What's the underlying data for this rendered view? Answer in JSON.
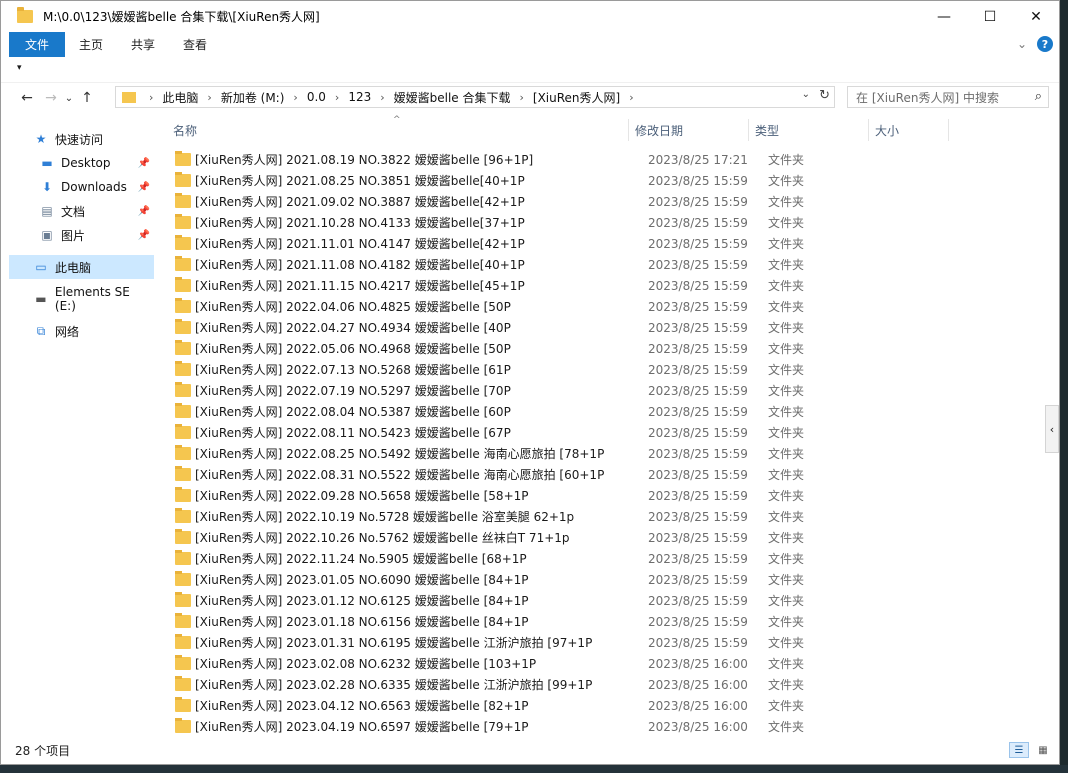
{
  "window": {
    "title": "M:\\0.0\\123\\嫒嫒酱belle 合集下载\\[XiuRen秀人网]",
    "min_glyph": "—",
    "max_glyph": "☐",
    "close_glyph": "✕"
  },
  "ribbon": {
    "tabs": [
      "文件",
      "主页",
      "共享",
      "查看"
    ],
    "expand_glyph": "⌄",
    "help_glyph": "?"
  },
  "qat": {
    "arrow": "▾"
  },
  "nav": {
    "back": "←",
    "forward": "→",
    "recent": "⌄",
    "up": "↑"
  },
  "address": {
    "crumbs": [
      "此电脑",
      "新加卷 (M:)",
      "0.0",
      "123",
      "嫒嫒酱belle 合集下载",
      "[XiuRen秀人网]"
    ],
    "sep": "›",
    "dropdown": "⌄",
    "refresh": "↻"
  },
  "search": {
    "placeholder": "在 [XiuRen秀人网] 中搜索",
    "icon": "⌕"
  },
  "sidebar": {
    "items": [
      {
        "label": "快速访问",
        "icon": "★",
        "pin": ""
      },
      {
        "label": "Desktop",
        "icon": "▬",
        "pin": "📌"
      },
      {
        "label": "Downloads",
        "icon": "⬇",
        "pin": "📌"
      },
      {
        "label": "文档",
        "icon": "▤",
        "pin": "📌"
      },
      {
        "label": "图片",
        "icon": "▣",
        "pin": "📌"
      },
      {
        "label": "此电脑",
        "icon": "▭",
        "pin": ""
      },
      {
        "label": "Elements SE (E:)",
        "icon": "▬",
        "pin": ""
      },
      {
        "label": "网络",
        "icon": "⧉",
        "pin": ""
      }
    ]
  },
  "columns": {
    "name": "名称",
    "date": "修改日期",
    "type": "类型",
    "size": "大小",
    "sort_glyph": "^"
  },
  "files": [
    {
      "name": "[XiuRen秀人网] 2021.08.19 NO.3822 嫒嫒酱belle [96+1P]",
      "date": "2023/8/25 17:21",
      "type": "文件夹"
    },
    {
      "name": "[XiuRen秀人网] 2021.08.25 NO.3851 嫒嫒酱belle[40+1P",
      "date": "2023/8/25 15:59",
      "type": "文件夹"
    },
    {
      "name": "[XiuRen秀人网] 2021.09.02 NO.3887 嫒嫒酱belle[42+1P",
      "date": "2023/8/25 15:59",
      "type": "文件夹"
    },
    {
      "name": "[XiuRen秀人网] 2021.10.28 NO.4133 嫒嫒酱belle[37+1P",
      "date": "2023/8/25 15:59",
      "type": "文件夹"
    },
    {
      "name": "[XiuRen秀人网] 2021.11.01 NO.4147 嫒嫒酱belle[42+1P",
      "date": "2023/8/25 15:59",
      "type": "文件夹"
    },
    {
      "name": "[XiuRen秀人网] 2021.11.08 NO.4182 嫒嫒酱belle[40+1P",
      "date": "2023/8/25 15:59",
      "type": "文件夹"
    },
    {
      "name": "[XiuRen秀人网] 2021.11.15 NO.4217 嫒嫒酱belle[45+1P",
      "date": "2023/8/25 15:59",
      "type": "文件夹"
    },
    {
      "name": "[XiuRen秀人网] 2022.04.06 NO.4825 嫒嫒酱belle [50P",
      "date": "2023/8/25 15:59",
      "type": "文件夹"
    },
    {
      "name": "[XiuRen秀人网] 2022.04.27 NO.4934 嫒嫒酱belle [40P",
      "date": "2023/8/25 15:59",
      "type": "文件夹"
    },
    {
      "name": "[XiuRen秀人网] 2022.05.06 NO.4968 嫒嫒酱belle [50P",
      "date": "2023/8/25 15:59",
      "type": "文件夹"
    },
    {
      "name": "[XiuRen秀人网] 2022.07.13 NO.5268 嫒嫒酱belle [61P",
      "date": "2023/8/25 15:59",
      "type": "文件夹"
    },
    {
      "name": "[XiuRen秀人网] 2022.07.19 NO.5297 嫒嫒酱belle [70P",
      "date": "2023/8/25 15:59",
      "type": "文件夹"
    },
    {
      "name": "[XiuRen秀人网] 2022.08.04 NO.5387 嫒嫒酱belle [60P",
      "date": "2023/8/25 15:59",
      "type": "文件夹"
    },
    {
      "name": "[XiuRen秀人网] 2022.08.11 NO.5423 嫒嫒酱belle [67P",
      "date": "2023/8/25 15:59",
      "type": "文件夹"
    },
    {
      "name": "[XiuRen秀人网] 2022.08.25 NO.5492 嫒嫒酱belle 海南心愿旅拍 [78+1P",
      "date": "2023/8/25 15:59",
      "type": "文件夹"
    },
    {
      "name": "[XiuRen秀人网] 2022.08.31 NO.5522 嫒嫒酱belle 海南心愿旅拍 [60+1P",
      "date": "2023/8/25 15:59",
      "type": "文件夹"
    },
    {
      "name": "[XiuRen秀人网] 2022.09.28 NO.5658 嫒嫒酱belle [58+1P",
      "date": "2023/8/25 15:59",
      "type": "文件夹"
    },
    {
      "name": "[XiuRen秀人网] 2022.10.19 No.5728 嫒嫒酱belle 浴室美腿 62+1p",
      "date": "2023/8/25 15:59",
      "type": "文件夹"
    },
    {
      "name": "[XiuRen秀人网] 2022.10.26 No.5762 嫒嫒酱belle 丝袜白T 71+1p",
      "date": "2023/8/25 15:59",
      "type": "文件夹"
    },
    {
      "name": "[XiuRen秀人网] 2022.11.24 No.5905 嫒嫒酱belle [68+1P",
      "date": "2023/8/25 15:59",
      "type": "文件夹"
    },
    {
      "name": "[XiuRen秀人网] 2023.01.05 NO.6090 嫒嫒酱belle [84+1P",
      "date": "2023/8/25 15:59",
      "type": "文件夹"
    },
    {
      "name": "[XiuRen秀人网] 2023.01.12 NO.6125 嫒嫒酱belle [84+1P",
      "date": "2023/8/25 15:59",
      "type": "文件夹"
    },
    {
      "name": "[XiuRen秀人网] 2023.01.18 NO.6156 嫒嫒酱belle [84+1P",
      "date": "2023/8/25 15:59",
      "type": "文件夹"
    },
    {
      "name": "[XiuRen秀人网] 2023.01.31 NO.6195 嫒嫒酱belle 江浙沪旅拍 [97+1P",
      "date": "2023/8/25 15:59",
      "type": "文件夹"
    },
    {
      "name": "[XiuRen秀人网] 2023.02.08 NO.6232 嫒嫒酱belle [103+1P",
      "date": "2023/8/25 16:00",
      "type": "文件夹"
    },
    {
      "name": "[XiuRen秀人网] 2023.02.28 NO.6335 嫒嫒酱belle 江浙沪旅拍 [99+1P",
      "date": "2023/8/25 16:00",
      "type": "文件夹"
    },
    {
      "name": "[XiuRen秀人网] 2023.04.12 NO.6563 嫒嫒酱belle [82+1P",
      "date": "2023/8/25 16:00",
      "type": "文件夹"
    },
    {
      "name": "[XiuRen秀人网] 2023.04.19 NO.6597 嫒嫒酱belle [79+1P",
      "date": "2023/8/25 16:00",
      "type": "文件夹"
    }
  ],
  "status": {
    "count": "28 个项目",
    "details_glyph": "☰",
    "tiles_glyph": "▦"
  },
  "scroll": {
    "collapse_glyph": "‹"
  }
}
